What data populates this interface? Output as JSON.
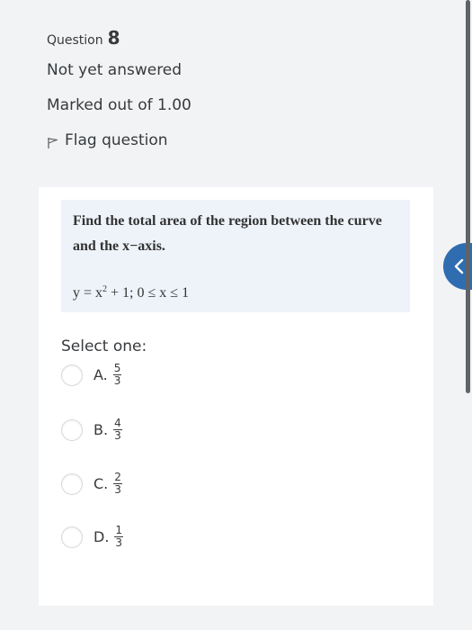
{
  "question_info": {
    "question_label": "Question",
    "question_number": "8",
    "state": "Not yet answered",
    "grade": "Marked out of 1.00",
    "flag_label": "Flag question"
  },
  "question": {
    "text": "Find the total area of the region between the curve and the x−axis.",
    "equation_lhs": "y = x",
    "equation_exp": "2",
    "equation_rhs": " + 1; 0 ≤ x ≤ 1"
  },
  "answer": {
    "prompt": "Select one:",
    "options": [
      {
        "letter": "A.",
        "numerator": "5",
        "denominator": "3"
      },
      {
        "letter": "B.",
        "numerator": "4",
        "denominator": "3"
      },
      {
        "letter": "C.",
        "numerator": "2",
        "denominator": "3"
      },
      {
        "letter": "D.",
        "numerator": "1",
        "denominator": "3"
      }
    ]
  },
  "colors": {
    "page_background": "#f2f3f5",
    "question_text_background": "#eef3f9",
    "side_tab": "#2f6db0"
  },
  "icons": {
    "flag": "flag-icon",
    "side_tab": "chevron-left-icon"
  }
}
